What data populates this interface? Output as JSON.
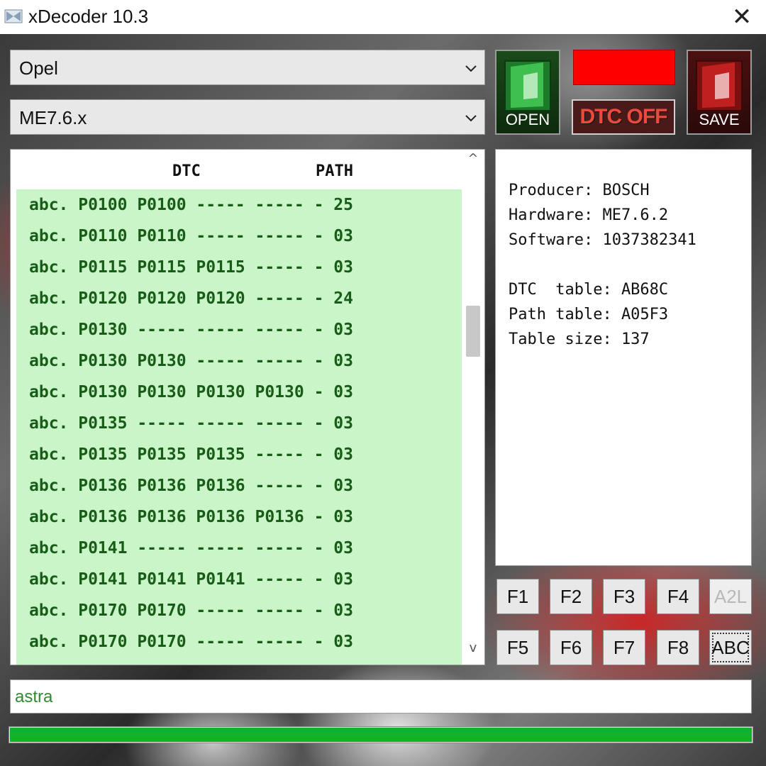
{
  "window": {
    "title": "xDecoder 10.3",
    "close_glyph": "✕",
    "icon": "app-icon"
  },
  "selectors": {
    "make": "Opel",
    "ecu": "ME7.6.x"
  },
  "buttons": {
    "open_label": "OPEN",
    "save_label": "SAVE",
    "dtc_off_label": "DTC OFF",
    "indicator_color": "#ff0000"
  },
  "dtc_list": {
    "header_dtc": "DTC",
    "header_path": "PATH",
    "rows": [
      "abc. P0100 P0100 ----- ----- - 25",
      "abc. P0110 P0110 ----- ----- - 03",
      "abc. P0115 P0115 P0115 ----- - 03",
      "abc. P0120 P0120 P0120 ----- - 24",
      "abc. P0130 ----- ----- ----- - 03",
      "abc. P0130 P0130 ----- ----- - 03",
      "abc. P0130 P0130 P0130 P0130 - 03",
      "abc. P0135 ----- ----- ----- - 03",
      "abc. P0135 P0135 P0135 ----- - 03",
      "abc. P0136 P0136 P0136 ----- - 03",
      "abc. P0136 P0136 P0136 P0136 - 03",
      "abc. P0141 ----- ----- ----- - 03",
      "abc. P0141 P0141 P0141 ----- - 03",
      "abc. P0170 P0170 ----- ----- - 03",
      "abc. P0170 P0170 ----- ----- - 03"
    ],
    "row_background": "#c9f5c9",
    "row_text_color": "#185c18",
    "scroll_position": 0.32
  },
  "info": {
    "producer": "Producer: BOSCH",
    "hardware": "Hardware: ME7.6.2",
    "software": "Software: 1037382341",
    "dtc_table": "DTC  table: AB68C",
    "path_table": "Path table: A05F3",
    "table_size": "Table size: 137"
  },
  "function_keys": {
    "f1": "F1",
    "f2": "F2",
    "f3": "F3",
    "f4": "F4",
    "a2l": "A2L",
    "f5": "F5",
    "f6": "F6",
    "f7": "F7",
    "f8": "F8",
    "abc": "ABC"
  },
  "search": {
    "value": "astra"
  },
  "progress": {
    "fraction": 1.0,
    "color": "#12b12c"
  }
}
